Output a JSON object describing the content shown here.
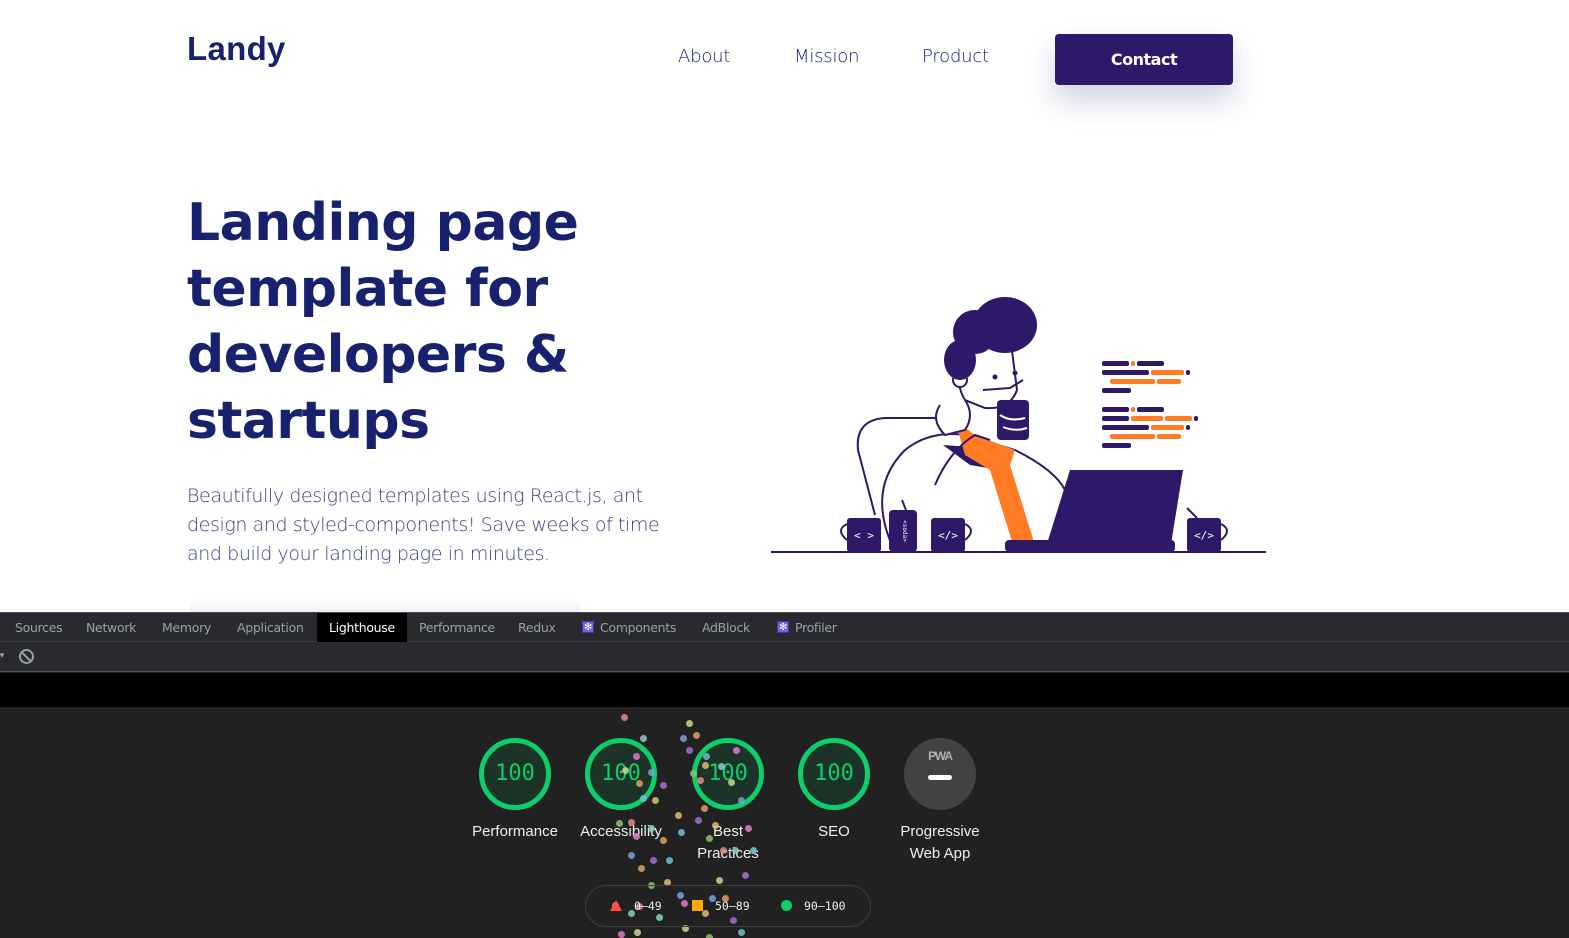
{
  "site": {
    "logo": "Landy",
    "nav": [
      {
        "label": "About"
      },
      {
        "label": "Mission"
      },
      {
        "label": "Product"
      }
    ],
    "contact_label": "Contact",
    "hero_title": "Landing page template for developers & startups",
    "hero_description": "Beautifully designed templates using React.js, ant design and styled-components! Save weeks of time and build your landing page in minutes.",
    "illustration": {
      "subject": "developer-with-coffee-and-laptop",
      "mug_labels": [
        "< >",
        "</>",
        "</>"
      ],
      "can_label": "<soda>"
    },
    "colors": {
      "brand": "#18216d",
      "button": "#2e186a",
      "accent": "#ff7c25"
    }
  },
  "devtools": {
    "tabs": [
      {
        "label": "Sources",
        "active": false,
        "react": false
      },
      {
        "label": "Network",
        "active": false,
        "react": false
      },
      {
        "label": "Memory",
        "active": false,
        "react": false
      },
      {
        "label": "Application",
        "active": false,
        "react": false
      },
      {
        "label": "Lighthouse",
        "active": true,
        "react": false
      },
      {
        "label": "Performance",
        "active": false,
        "react": false
      },
      {
        "label": "Redux",
        "active": false,
        "react": false
      },
      {
        "label": "Components",
        "active": false,
        "react": true
      },
      {
        "label": "AdBlock",
        "active": false,
        "react": false
      },
      {
        "label": "Profiler",
        "active": false,
        "react": true
      }
    ],
    "toolbar": {
      "clear_icon": "block-icon"
    }
  },
  "lighthouse": {
    "gauges": [
      {
        "label": "Performance",
        "score": "100"
      },
      {
        "label": "Accessibility",
        "score": "100"
      },
      {
        "label": "Best Practices",
        "score": "100"
      },
      {
        "label": "SEO",
        "score": "100"
      }
    ],
    "pwa": {
      "label": "Progressive Web App",
      "badge": "PWA",
      "score": "—"
    },
    "legend": [
      {
        "range": "0–49",
        "shape": "triangle",
        "color": "#ff4e42"
      },
      {
        "range": "50–89",
        "shape": "square",
        "color": "#ffa400"
      },
      {
        "range": "90–100",
        "shape": "circle",
        "color": "#0cce6b"
      }
    ],
    "colors": {
      "pass": "#0cce6b",
      "average": "#ffa400",
      "fail": "#ff4e42"
    }
  }
}
